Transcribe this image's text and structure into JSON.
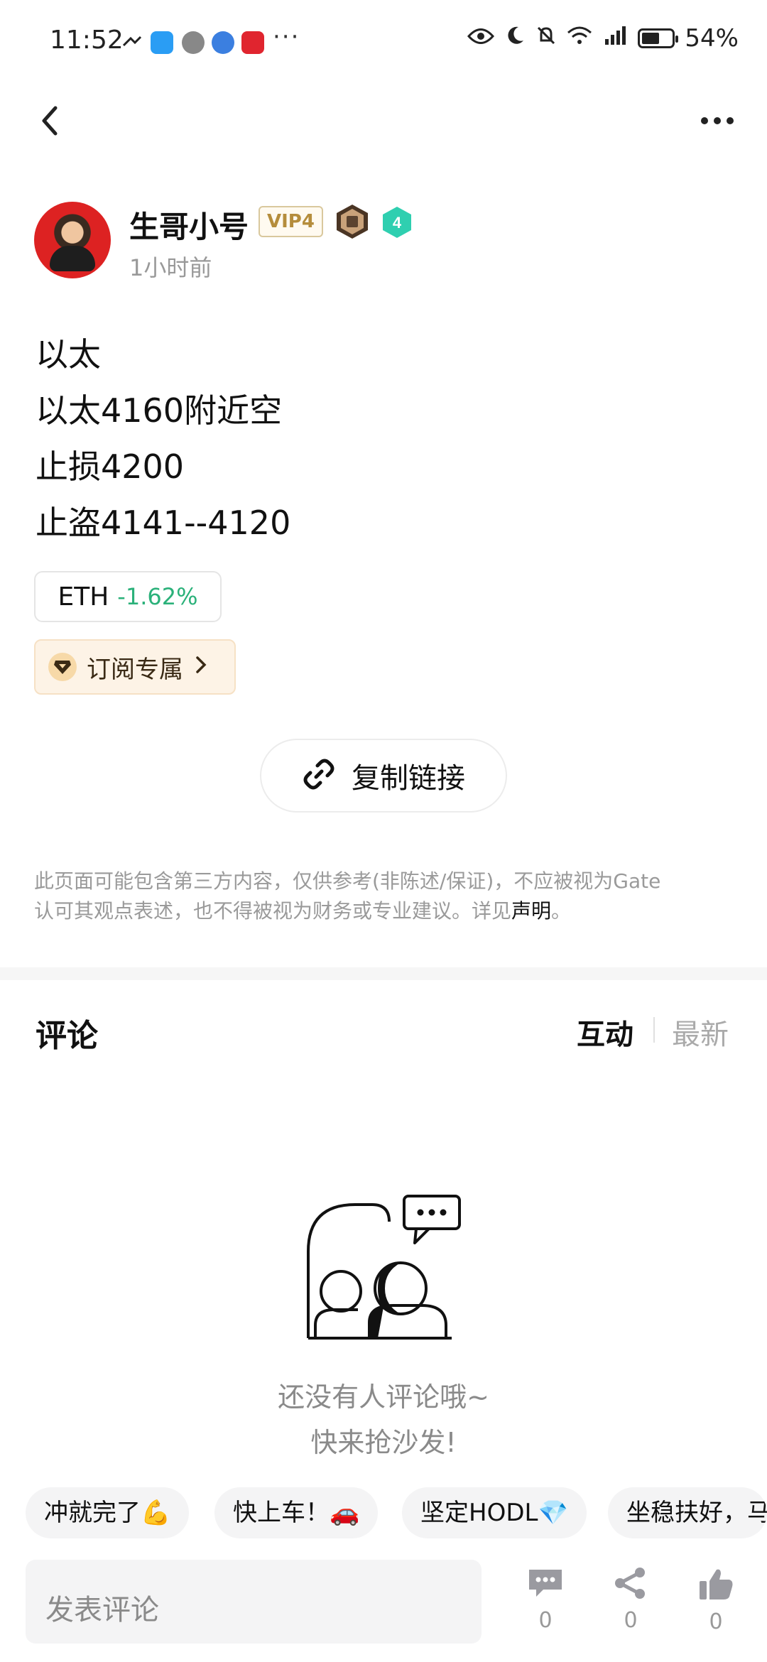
{
  "status_bar": {
    "time": "11:52",
    "more": "···",
    "battery": "54%"
  },
  "nav": {
    "back_icon": "chevron-left-icon",
    "more_icon": "more-horizontal-icon"
  },
  "author": {
    "name": "生哥小号",
    "vip": "VIP4",
    "level": "4",
    "time_ago": "1小时前"
  },
  "post": {
    "lines": [
      "以太",
      "以太4160附近空",
      "止损4200",
      "止盗4141--4120"
    ],
    "ticker": {
      "symbol": "ETH",
      "change": "-1.62%"
    },
    "subscribe_label": "订阅专属",
    "copy_link_label": "复制链接"
  },
  "disclaimer": {
    "line1": "此页面可能包含第三方内容，仅供参考(非陈述/保证)，不应被视为Gate",
    "line2_prefix": "认可其观点表述，也不得被视为财务或专业建议。详见",
    "link": "声明",
    "suffix": "。"
  },
  "comments": {
    "title": "评论",
    "tab_interact": "互动",
    "tab_latest": "最新",
    "empty_line1": "还没有人评论哦~",
    "empty_line2": "快来抢沙发!"
  },
  "quick_replies": [
    "冲就完了💪",
    "快上车！🚗",
    "坚定HODL💎",
    "坐稳扶好，马"
  ],
  "bottom_bar": {
    "placeholder": "发表评论",
    "comment_count": "0",
    "share_count": "0",
    "like_count": "0"
  },
  "colors": {
    "positive": "#2bb17a",
    "vip_gold": "#b58d3c",
    "subscribe_bg": "#fdf3e6"
  }
}
